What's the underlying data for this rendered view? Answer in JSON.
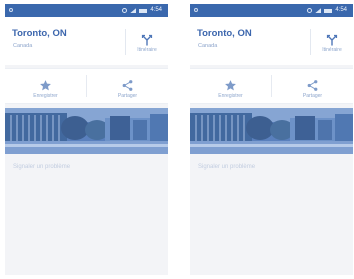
{
  "screens": [
    {
      "status": {
        "time": "4:54"
      },
      "place": {
        "title": "Toronto, ON",
        "subtitle": "Canada"
      },
      "actions": {
        "directions_label": "Itinéraire",
        "save_label": "Enregistrer",
        "share_label": "Partager"
      },
      "report_label": "Signaler un problème"
    },
    {
      "status": {
        "time": "4:54"
      },
      "place": {
        "title": "Toronto, ON",
        "subtitle": "Canada"
      },
      "actions": {
        "directions_label": "Itinéraire",
        "save_label": "Enregistrer",
        "share_label": "Partager"
      },
      "report_label": "Signaler un problème"
    }
  ],
  "colors": {
    "status_bar": "#3a68ad",
    "accent": "#3c66ad",
    "secondary_text": "#8ea6cc",
    "panel_bg": "#f3f4f7"
  },
  "icons": [
    "directions-icon",
    "star-icon",
    "share-icon"
  ]
}
